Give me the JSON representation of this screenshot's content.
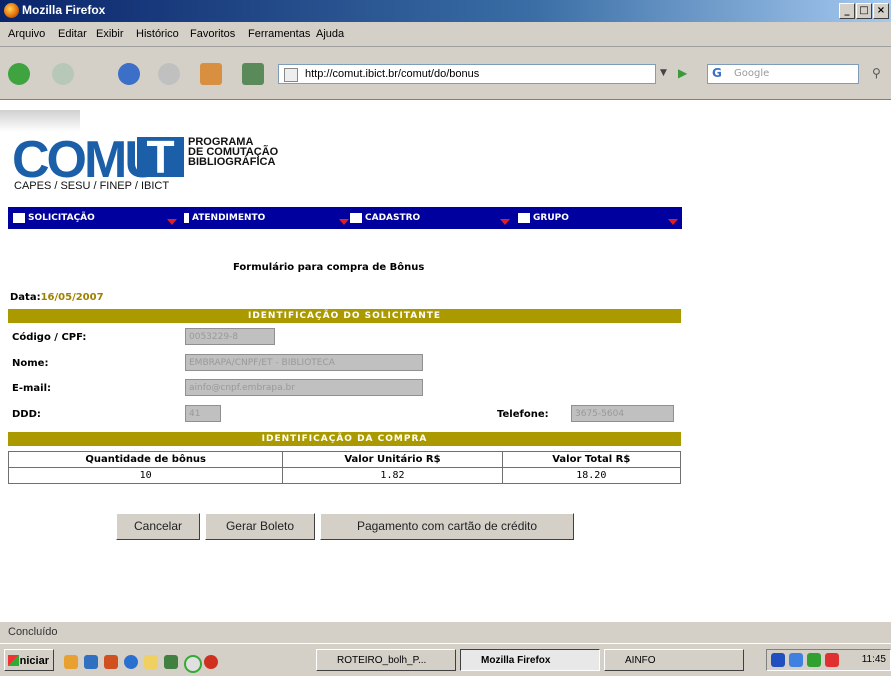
{
  "window": {
    "title": "Mozilla Firefox"
  },
  "menu": [
    "Arquivo",
    "Editar",
    "Exibir",
    "Histórico",
    "Favoritos",
    "Ferramentas",
    "Ajuda"
  ],
  "address": {
    "url": "http://comut.ibict.br/comut/do/bonus"
  },
  "search": {
    "placeholder": "Google"
  },
  "logo": {
    "word": "COMUT",
    "line1": "PROGRAMA",
    "line2": "DE COMUTAÇÃO",
    "line3": "BIBLIOGRÁFICA",
    "sponsors": "CAPES / SESU / FINEP / IBICT"
  },
  "nav": [
    {
      "label": "SOLICITAÇÃO"
    },
    {
      "label": "ATENDIMENTO"
    },
    {
      "label": "CADASTRO"
    },
    {
      "label": "GRUPO"
    }
  ],
  "form": {
    "title": "Formulário para compra de Bônus",
    "date_label": "Data:",
    "date_value": "16/05/2007",
    "section1": "IDENTIFICAÇÃO DO SOLICITANTE",
    "codigo_label": "Código / CPF:",
    "codigo_value": "0053229-8",
    "nome_label": "Nome:",
    "nome_value": "EMBRAPA/CNPF/ET - BIBLIOTECA",
    "email_label": "E-mail:",
    "email_value": "ainfo@cnpf.embrapa.br",
    "ddd_label": "DDD:",
    "ddd_value": "41",
    "telefone_label": "Telefone:",
    "telefone_value": "3675-5604",
    "section2": "IDENTIFICAÇÃO DA COMPRA",
    "table": {
      "headers": [
        "Quantidade de bônus",
        "Valor Unitário R$",
        "Valor Total R$"
      ],
      "row": [
        "10",
        "1.82",
        "18.20"
      ]
    }
  },
  "buttons": {
    "cancel": "Cancelar",
    "boleto": "Gerar Boleto",
    "card": "Pagamento com cartão de crédito"
  },
  "status": {
    "text": "Concluído"
  },
  "taskbar": {
    "start": "Iniciar",
    "tasks": [
      "ROTEIRO_bolh_P...",
      "Mozilla Firefox",
      "AINFO"
    ],
    "clock": "11:45"
  },
  "colors": {
    "nav_blue": "#00009e",
    "section_bar": "#aa9a00",
    "logo_blue": "#1a5fa8"
  }
}
